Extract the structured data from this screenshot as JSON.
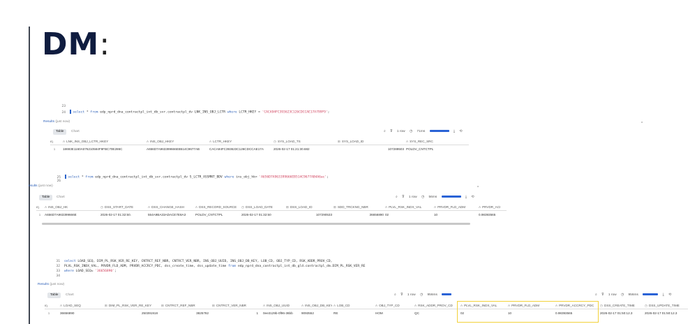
{
  "slide": {
    "title": "DM",
    "colon": ":"
  },
  "queries": [
    {
      "lines": [
        {
          "ln": "23",
          "text": "",
          "parts": []
        },
        {
          "ln": "24",
          "parts": [
            {
              "t": "select",
              "k": "kw"
            },
            {
              "t": " * ",
              "k": ""
            },
            {
              "t": "from",
              "k": "kw"
            },
            {
              "t": " edp_nprd_dna_contractpl_int_db_svr.contractpl_dv LNK_INS_OBJ_LCTR ",
              "k": ""
            },
            {
              "t": "where",
              "k": "kw"
            },
            {
              "t": " LCTR_HKEY = ",
              "k": ""
            },
            {
              "t": "'CACA94FC393623C126CDCCAE17A799F9'",
              "k": "str"
            },
            {
              "t": ";",
              "k": ""
            }
          ]
        }
      ],
      "results": {
        "label": "Results",
        "time": "(just now)"
      },
      "tabs": [
        "Table",
        "Chart"
      ],
      "toolbar": {
        "rows": "1 row",
        "time": "71ms"
      },
      "columns": [
        "#",
        "LNK_INS_OBJ_LCTR_HKEY",
        "INS_OBJ_HKEY",
        "LCTR_HKEY",
        "SYS_LOAD_TS",
        "SYS_LOAD_ID",
        "SYS_REC_SRC"
      ],
      "rows": [
        [
          "1",
          "18693E1160A076210584F9FBC70E286C",
          "A656D7A963399666EB514C9677AB",
          "CACA94FC393623C126CDCCAE17A",
          "2026-02-17 01:21:30.682",
          "107289503",
          "POLDV_CNTCTPL"
        ]
      ]
    },
    {
      "lines": [
        {
          "ln": "25",
          "parts": [
            {
              "t": "select",
              "k": "kw"
            },
            {
              "t": " * ",
              "k": ""
            },
            {
              "t": "from",
              "k": "kw"
            },
            {
              "t": " edp_nprd_dna_contractpl_int_db_svr.contractpl_dv S_LCTR_ASSMNT_BDV ",
              "k": ""
            },
            {
              "t": "where",
              "k": "kw"
            },
            {
              "t": " ins_obj_hk= ",
              "k": ""
            },
            {
              "t": "'A656D7A963399666EB514C9677AB4A6ac'",
              "k": "str"
            },
            {
              "t": ";",
              "k": ""
            }
          ]
        },
        {
          "ln": "26",
          "parts": []
        }
      ],
      "results": {
        "label": "esults",
        "time": "(just now)"
      },
      "tabs": [
        "Table",
        "Chart"
      ],
      "toolbar": {
        "rows": "1 row",
        "time": "56ms"
      },
      "columns": [
        "#",
        "INS_OBJ_HK",
        "DSS_START_DATE",
        "DSS_CHANGE_HASH",
        "DSS_RECORD_SOURCE",
        "DSS_LOAD_DATE",
        "DSS_LOAD_ID",
        "SDD_TRCKNG_NBR",
        "PLVL_RSK_INDX_VAL",
        "PRVDR_FLD_ADM",
        "PRVDR_ACI"
      ],
      "rows": [
        [
          "1",
          "A656D7A963399666E",
          "2026-02-17 01:32:50.",
          "554A9BA33ADACE7E8A3",
          "POLDV_CNTCTPL",
          "2026-02-17 01:32:50",
          "107290533",
          "36656890",
          "02",
          "10",
          "0.98393565"
        ]
      ]
    },
    {
      "lines": [
        {
          "ln": "31",
          "parts": [
            {
              "t": "select",
              "k": "kw"
            },
            {
              "t": " LOAD_SEQ, DIM_PL_RSK_VER_RE_KEY, CNTRCT_REF_NBR, CNTRCT_VER_NBR, INS_OBJ_UUID, INS_OBJ_DB_KEY, LOB_CD, OBJ_TYP_CD, RSK_ADDR_PROV_CD,",
              "k": ""
            }
          ]
        },
        {
          "ln": "32",
          "parts": [
            {
              "t": "PLVL_RSK_INDX_VAL, PRVDR_FLD_ADM, PRVDR_ACCRCY_PDC, dss_create_time, dss_update_time ",
              "k": ""
            },
            {
              "t": "from",
              "k": "kw"
            },
            {
              "t": " edp_nprd_dna_contractpl_int_db_gld.contractpl_dm.DIM_PL_RSK_VER_RE",
              "k": ""
            }
          ]
        },
        {
          "ln": "33",
          "parts": [
            {
              "t": "where",
              "k": "kw"
            },
            {
              "t": " LOAD_SEQ= ",
              "k": ""
            },
            {
              "t": "'36656890'",
              "k": "str"
            },
            {
              "t": ";",
              "k": ""
            }
          ]
        },
        {
          "ln": "34",
          "parts": []
        }
      ],
      "results": {
        "label": "Results",
        "time": "(just now)"
      },
      "tabs": [
        "Table",
        "Chart"
      ],
      "toolbar": {
        "rows": "1 row",
        "time": "956ms"
      },
      "toolbar2": {
        "rows": "1 row",
        "time": "956ms"
      },
      "columns": [
        "#",
        "LOAD_SEQ",
        "DIM_PL_RSK_VER_RE_KEY",
        "CNTRCT_REF_NBR",
        "CNTRCT_VER_NBR",
        "INS_OBJ_UUID",
        "INS_OBJ_DB_KEY",
        "LOB_CD",
        "OBJ_TYP_CD",
        "RSK_ADDR_PROV_CD",
        "PLVL_RSK_INDX_VAL",
        "PRVDR_FLD_ADM",
        "PRVDR_ACCRCY_PDC",
        "DSS_CREATE_TIME",
        "DSS_UPDATE_TIME"
      ],
      "rows": [
        [
          "1",
          "36656890",
          "250391918",
          "3825782",
          "1",
          "0ee3129b-0f96-36bb",
          "9093552",
          "RE",
          "HOM",
          "QC",
          "02",
          "10",
          "0.98393565",
          "2026-02-17 01:50:12.3",
          "2026-02-17 01:50:12.3"
        ]
      ]
    }
  ],
  "icons": {
    "search": "search-icon",
    "filter": "filter-icon",
    "clock": "clock-icon",
    "download": "download-icon",
    "history": "history-icon",
    "collapse": "collapse-icon"
  }
}
